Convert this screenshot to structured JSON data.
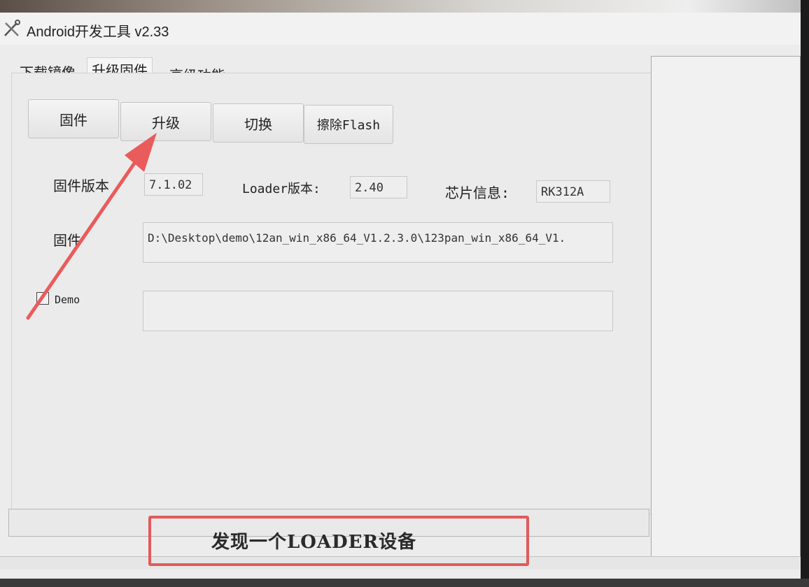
{
  "window": {
    "title": "Android开发工具 v2.33"
  },
  "tabs": [
    {
      "label": "下载镜像",
      "active": false
    },
    {
      "label": "升级固件",
      "active": true
    },
    {
      "label": "高级功能",
      "active": false
    }
  ],
  "toolbar": {
    "firmware_label": "固件",
    "upgrade_label": "升级",
    "switch_label": "切换",
    "erase_label": "擦除Flash"
  },
  "info": {
    "firmware_version_label": "固件版本",
    "firmware_version_value": "7.1.02",
    "loader_version_label": "Loader版本:",
    "loader_version_value": "2.40",
    "chip_info_label": "芯片信息:",
    "chip_info_value": "RK312A",
    "firmware_path_label": "固件",
    "firmware_path_value": "D:\\Desktop\\demo\\12an_win_x86_64_V1.2.3.0\\123pan_win_x86_64_V1.",
    "demo_label": "Demo",
    "demo_checked": false,
    "demo_path_value": ""
  },
  "status": {
    "message": "发现一个LOADER设备"
  },
  "colors": {
    "annotation_red": "#e25a5a",
    "window_bg": "#ececec"
  }
}
